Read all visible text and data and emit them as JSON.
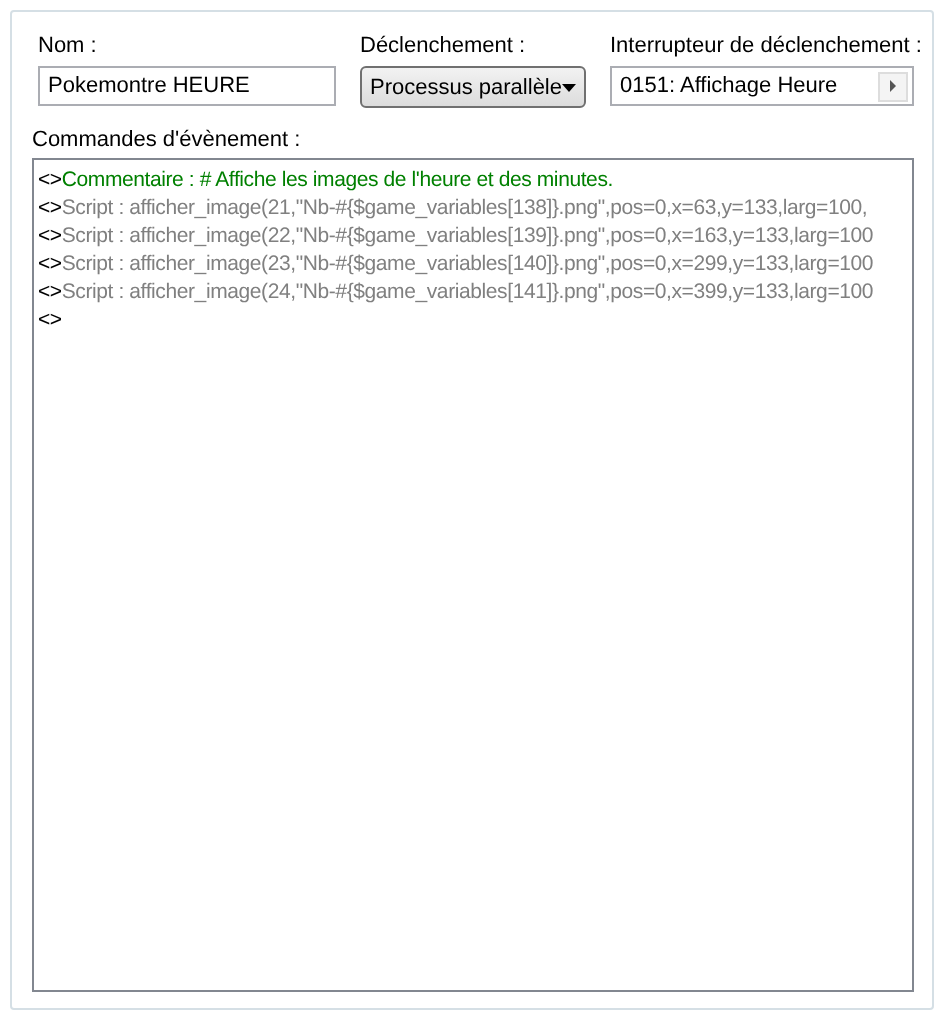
{
  "name_field": {
    "label": "Nom :",
    "value": "Pokemontre HEURE"
  },
  "trigger": {
    "label": "Déclenchement :",
    "value": "Processus parallèle"
  },
  "switch": {
    "label": "Interrupteur de déclenchement :",
    "value": "0151: Affichage Heure"
  },
  "commands": {
    "label": "Commandes d'évènement :",
    "lines": [
      {
        "marker": "<>",
        "kind": "comment",
        "text": "Commentaire : # Affiche les images de l'heure et des minutes."
      },
      {
        "marker": "<>",
        "kind": "script",
        "text": "Script : afficher_image(21,\"Nb-#{$game_variables[138]}.png\",pos=0,x=63,y=133,larg=100,"
      },
      {
        "marker": "<>",
        "kind": "script",
        "text": "Script : afficher_image(22,\"Nb-#{$game_variables[139]}.png\",pos=0,x=163,y=133,larg=100"
      },
      {
        "marker": "<>",
        "kind": "script",
        "text": "Script : afficher_image(23,\"Nb-#{$game_variables[140]}.png\",pos=0,x=299,y=133,larg=100"
      },
      {
        "marker": "<>",
        "kind": "script",
        "text": "Script : afficher_image(24,\"Nb-#{$game_variables[141]}.png\",pos=0,x=399,y=133,larg=100"
      },
      {
        "marker": "<>",
        "kind": "empty"
      }
    ]
  }
}
